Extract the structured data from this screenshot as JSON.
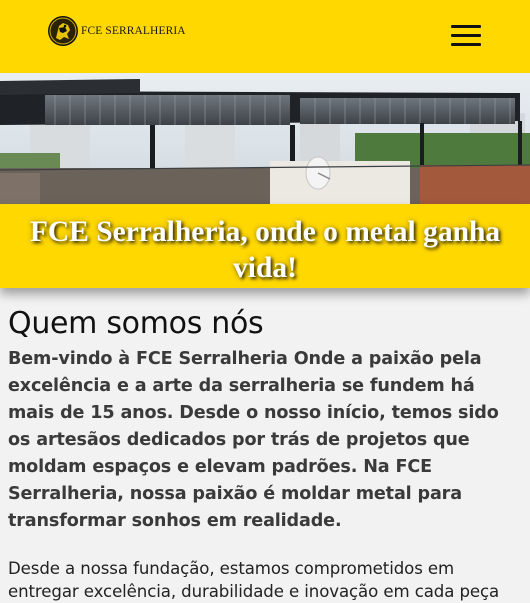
{
  "header": {
    "logo_text": "FCE SERRALHERIA",
    "background_color": "#ffd800",
    "menu_icon": "hamburger-menu-icon"
  },
  "hero": {
    "image": "rooftop-metal-structure-photo"
  },
  "banner": {
    "title": "FCE Serralheria, onde o metal ganha vida!"
  },
  "about": {
    "title": "Quem somos nós",
    "intro": "Bem-vindo à FCE Serralheria Onde a paixão pela excelência e a arte da serralheria se fundem há mais de 15 anos. Desde o nosso início, temos sido os artesãos dedicados por trás de projetos que moldam espaços e elevam padrões. Na FCE Serralheria, nossa paixão é moldar metal para transformar sonhos em realidade.",
    "body": "Desde a nossa fundação, estamos comprometidos em entregar excelência, durabilidade e inovação em cada peça"
  }
}
